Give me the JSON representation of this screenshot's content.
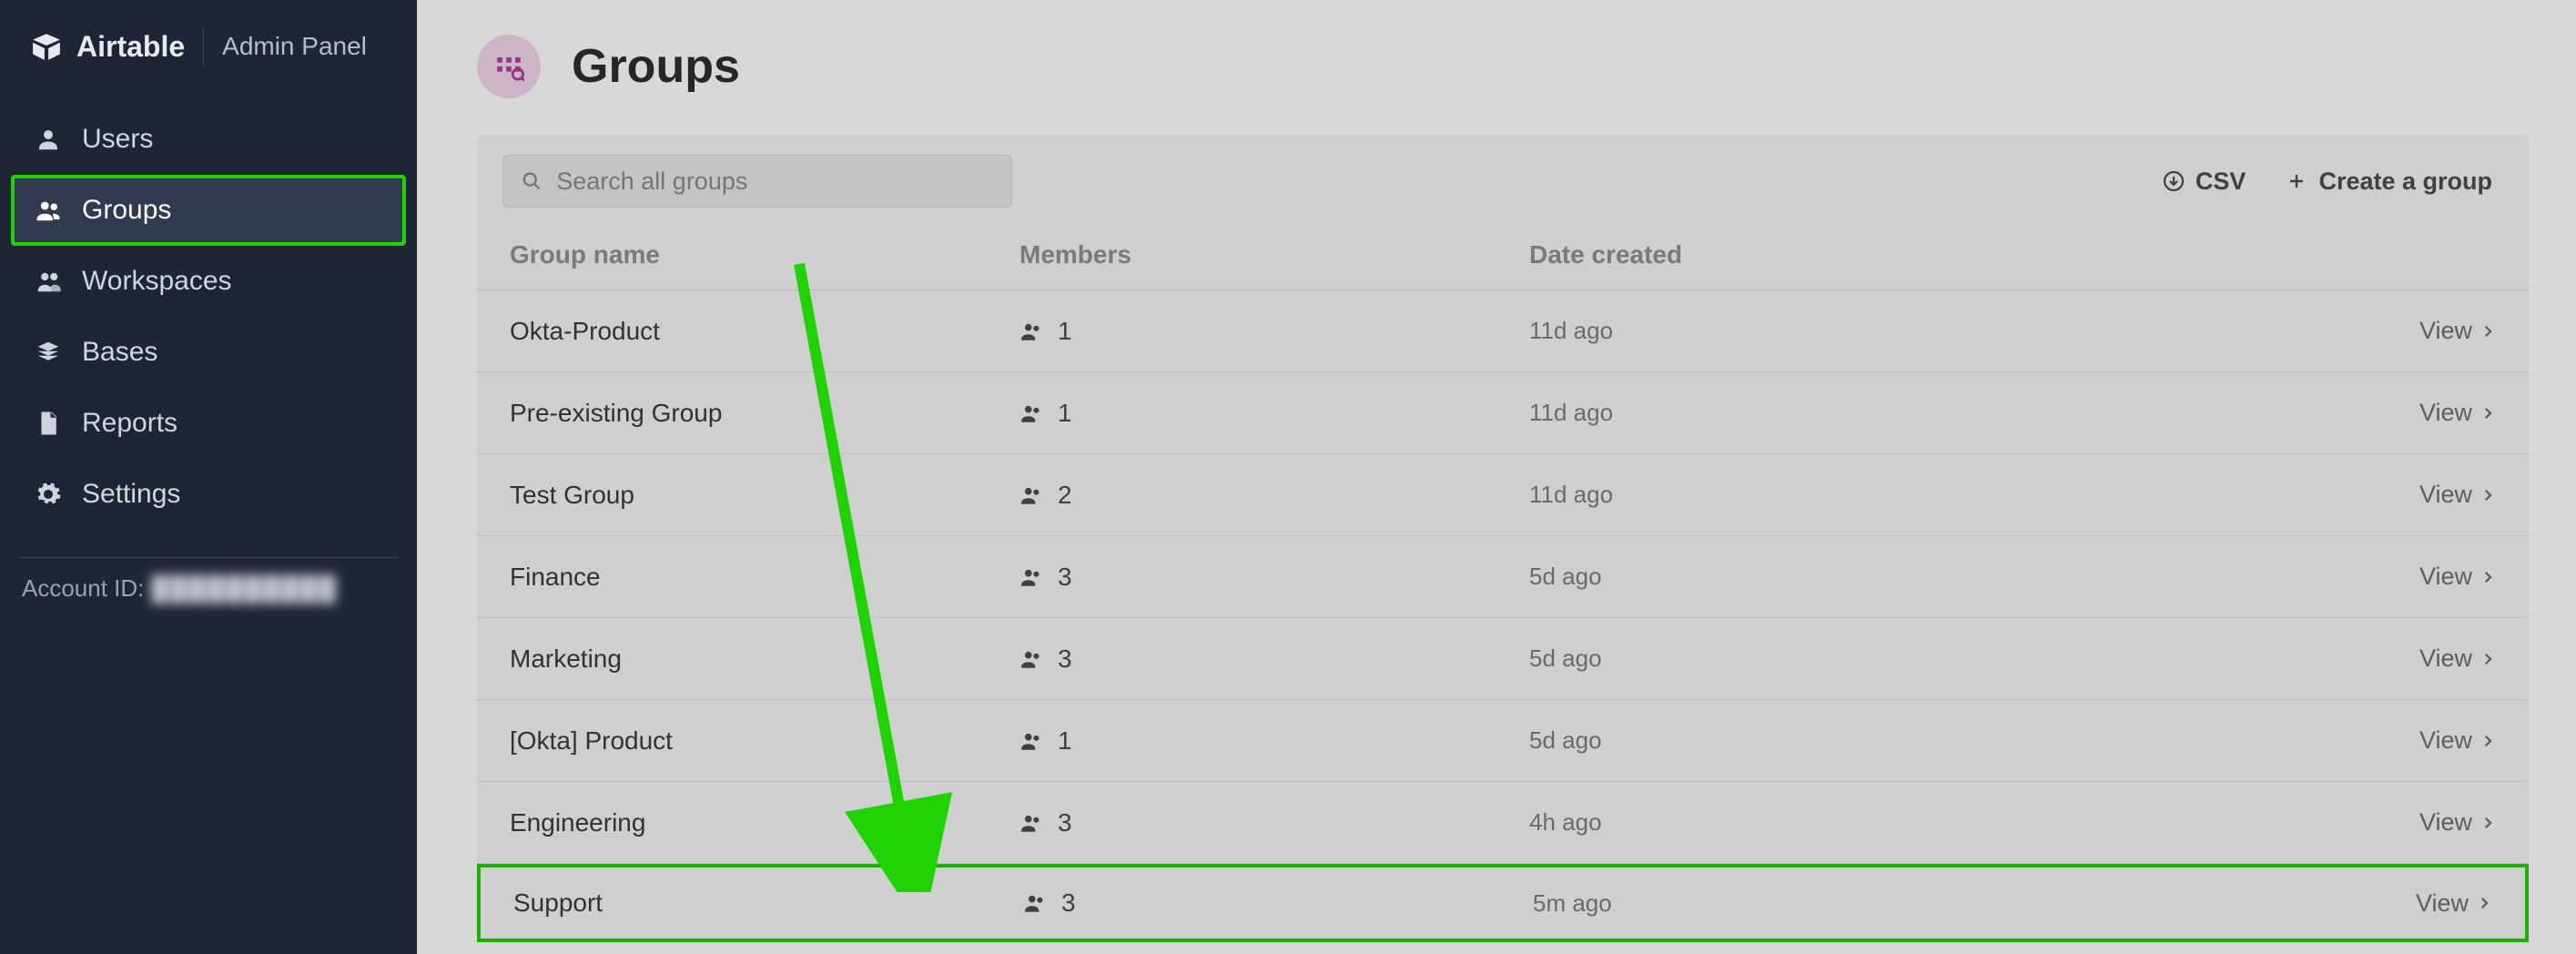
{
  "brand": {
    "name": "Airtable",
    "panel_label": "Admin Panel"
  },
  "sidebar": {
    "items": [
      {
        "label": "Users"
      },
      {
        "label": "Groups"
      },
      {
        "label": "Workspaces"
      },
      {
        "label": "Bases"
      },
      {
        "label": "Reports"
      },
      {
        "label": "Settings"
      }
    ],
    "account_id_label": "Account ID:",
    "account_id_value": "██████████"
  },
  "page": {
    "title": "Groups"
  },
  "toolbar": {
    "search_placeholder": "Search all groups",
    "csv_label": "CSV",
    "create_label": "Create a group"
  },
  "table": {
    "headers": {
      "name": "Group name",
      "members": "Members",
      "date": "Date created"
    },
    "view_label": "View",
    "rows": [
      {
        "name": "Okta-Product",
        "members": "1",
        "date": "11d ago"
      },
      {
        "name": "Pre-existing Group",
        "members": "1",
        "date": "11d ago"
      },
      {
        "name": "Test Group",
        "members": "2",
        "date": "11d ago"
      },
      {
        "name": "Finance",
        "members": "3",
        "date": "5d ago"
      },
      {
        "name": "Marketing",
        "members": "3",
        "date": "5d ago"
      },
      {
        "name": "[Okta] Product",
        "members": "1",
        "date": "5d ago"
      },
      {
        "name": "Engineering",
        "members": "3",
        "date": "4h ago"
      },
      {
        "name": "Support",
        "members": "3",
        "date": "5m ago"
      }
    ]
  }
}
